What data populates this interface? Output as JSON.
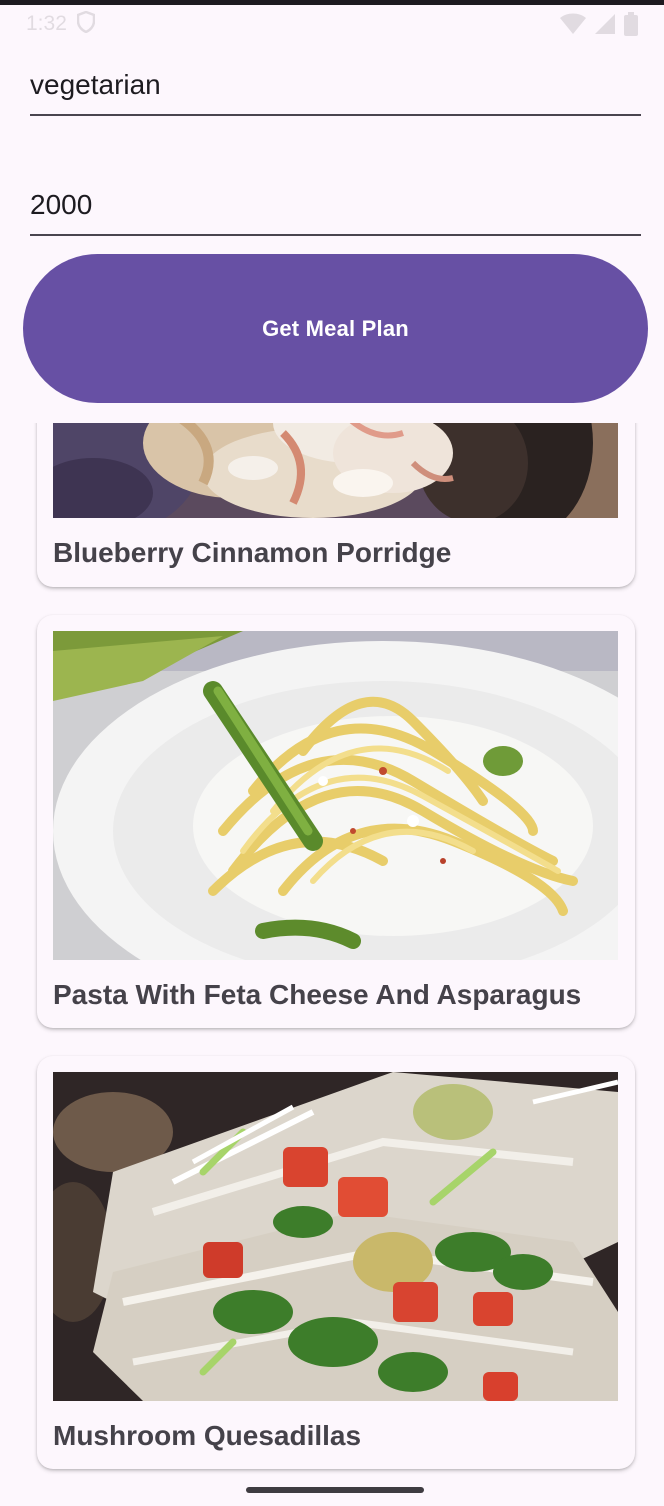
{
  "status_bar": {
    "time": "1:32",
    "icons": [
      "shield-icon",
      "wifi-icon",
      "signal-icon",
      "battery-icon"
    ]
  },
  "form": {
    "diet_value": "vegetarian",
    "calories_value": "2000",
    "submit_label": "Get Meal Plan"
  },
  "meals": [
    {
      "title": "Blueberry Cinnamon Porridge",
      "image": "porridge-photo"
    },
    {
      "title": "Pasta With Feta Cheese And Asparagus",
      "image": "pasta-photo"
    },
    {
      "title": "Mushroom Quesadillas",
      "image": "quesadilla-photo"
    }
  ],
  "colors": {
    "primary": "#6750a4",
    "background": "#fdf7fd",
    "title_text": "#45424a"
  }
}
